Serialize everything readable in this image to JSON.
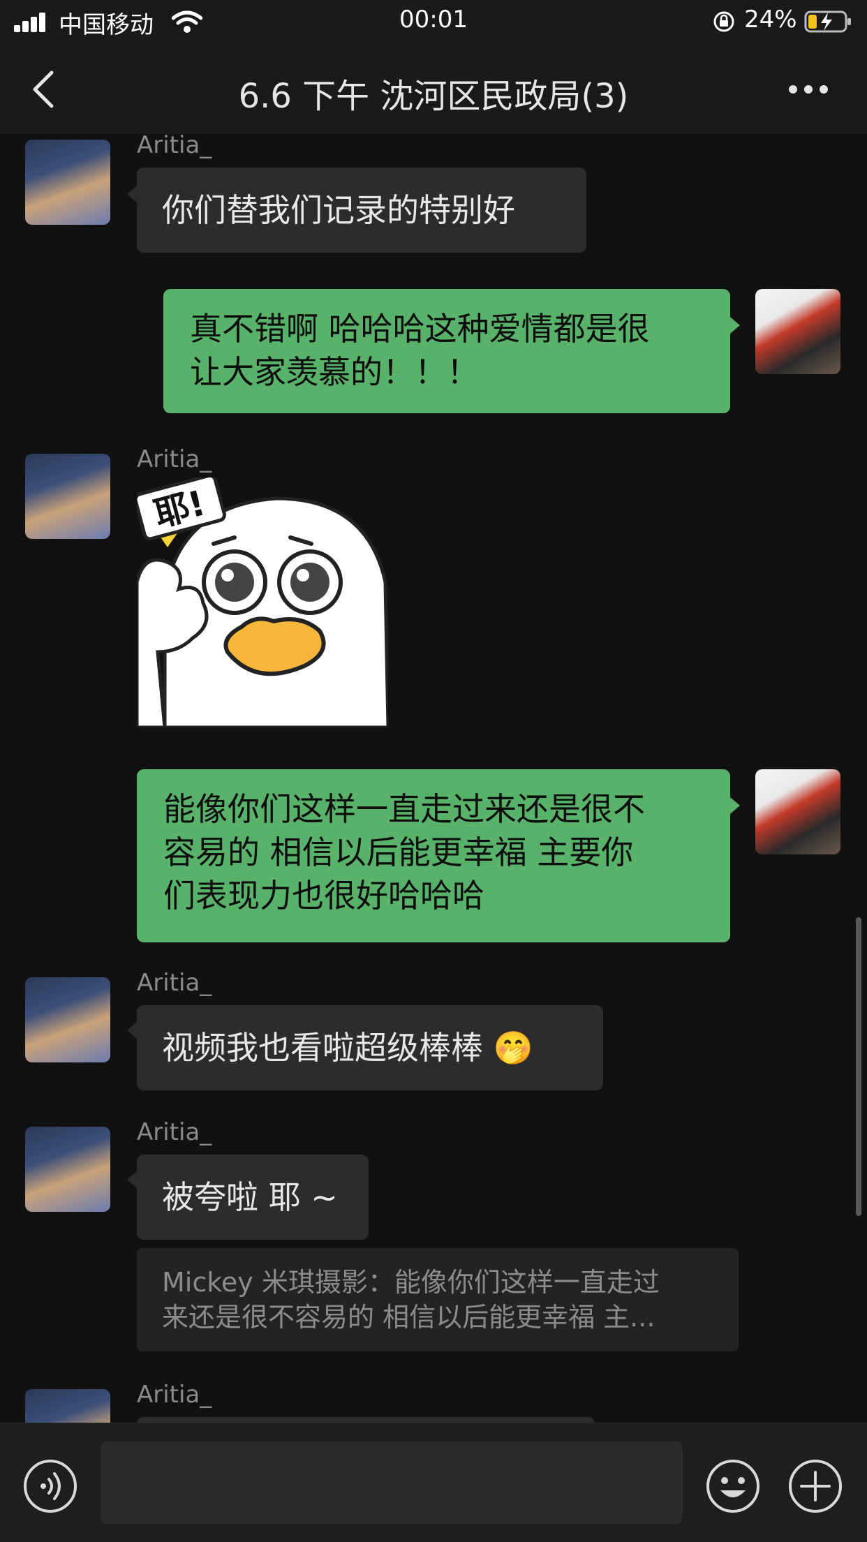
{
  "status_bar": {
    "carrier": "中国移动",
    "time": "00:01",
    "battery_percent": "24%",
    "battery_level": 0.24,
    "icons": [
      "signal-icon",
      "wifi-icon",
      "orientation-lock-icon",
      "battery-charging-icon"
    ]
  },
  "nav": {
    "title": "6.6 下午 沈河区民政局(3)",
    "back_icon": "chevron-left-icon",
    "more_icon": "more-dots-icon"
  },
  "messages": [
    {
      "sender": "Aritia_",
      "side": "left",
      "text": "你们替我们记录的特别好"
    },
    {
      "side": "right",
      "lines": [
        "真不错啊 哈哈哈这种爱情都是很",
        "让大家羡慕的！！！"
      ]
    },
    {
      "sender": "Aritia_",
      "side": "left",
      "type": "sticker",
      "sticker_text": "耶!"
    },
    {
      "side": "right",
      "lines": [
        "能像你们这样一直走过来还是很不",
        "容易的 相信以后能更幸福 主要你",
        "们表现力也很好哈哈哈"
      ]
    },
    {
      "sender": "Aritia_",
      "side": "left",
      "text": "视频我也看啦超级棒棒 🤭"
    },
    {
      "sender": "Aritia_",
      "side": "left",
      "text": "被夸啦 耶 ~",
      "quote_lines": [
        "Mickey 米琪摄影：能像你们这样一直走过",
        "来还是很不容易的 相信以后能更幸福 主..."
      ]
    },
    {
      "sender": "Aritia_",
      "side": "left",
      "text": ""
    }
  ],
  "input_bar": {
    "voice_icon": "voice-icon",
    "emoji_icon": "emoji-icon",
    "plus_icon": "plus-icon"
  },
  "colors": {
    "background": "#111111",
    "bubble_left": "#2c2c2c",
    "bubble_right": "#59b26a"
  }
}
